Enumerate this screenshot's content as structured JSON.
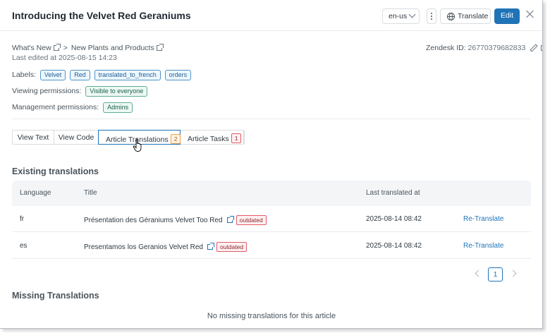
{
  "header": {
    "title": "Introducing the Velvet Red Geraniums",
    "locale": "en-us",
    "translate_label": "Translate",
    "edit_label": "Edit"
  },
  "breadcrumb": {
    "items": [
      "What's New",
      "New Plants and Products"
    ],
    "separator": ">"
  },
  "last_edited": "Last edited at 2025-08-15 14:23",
  "zendesk": {
    "label": "Zendesk ID:",
    "id": "26770379682833"
  },
  "labels": {
    "caption": "Labels:",
    "items": [
      "Velvet",
      "Red",
      "translated_to_french",
      "orders"
    ]
  },
  "viewing_permissions": {
    "caption": "Viewing permissions:",
    "value": "Visible to everyone"
  },
  "management_permissions": {
    "caption": "Management permissions:",
    "value": "Admins"
  },
  "tabs": [
    {
      "label": "View Text"
    },
    {
      "label": "View Code"
    },
    {
      "label": "Article Translations",
      "count": "2",
      "active": true
    },
    {
      "label": "Article Tasks",
      "count": "1"
    }
  ],
  "existing": {
    "heading": "Existing translations",
    "columns": [
      "Language",
      "Title",
      "Last translated at"
    ],
    "rows": [
      {
        "language": "fr",
        "title": "Présentation des Géraniums Velvet Too Red",
        "status": "outdated",
        "last_translated": "2025-08-14 08:42",
        "action": "Re-Translate"
      },
      {
        "language": "es",
        "title": "Presentamos los Geranios Velvet Red",
        "status": "outdated",
        "last_translated": "2025-08-14 08:42",
        "action": "Re-Translate"
      }
    ]
  },
  "pagination": {
    "current": "1"
  },
  "missing": {
    "heading": "Missing Translations",
    "empty_text": "No missing translations for this article"
  },
  "colors": {
    "primary": "#1f73b7",
    "outdated": "#e35b66",
    "tag_blue": "#5293c7",
    "tag_green": "#5eae91"
  }
}
